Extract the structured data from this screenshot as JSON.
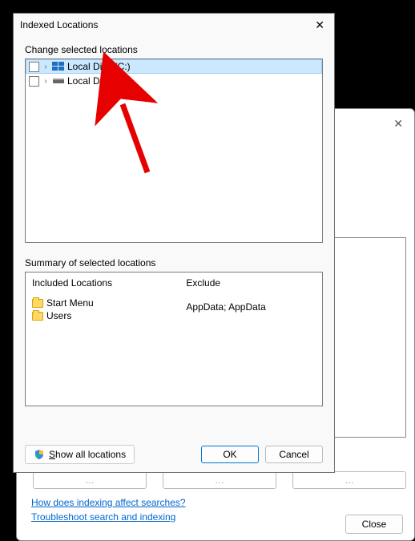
{
  "dialog": {
    "title": "Indexed Locations",
    "change_label": "Change selected locations",
    "locations": [
      {
        "label": "Local Disk (C:)",
        "selected": true,
        "icon": "win"
      },
      {
        "label": "Local Disk (E:)",
        "selected": false,
        "icon": "drive"
      }
    ],
    "summary_label": "Summary of selected locations",
    "included_header": "Included Locations",
    "exclude_header": "Exclude",
    "included": [
      {
        "label": "Start Menu"
      },
      {
        "label": "Users"
      }
    ],
    "exclude_text": "AppData; AppData",
    "show_all_label": "Show all locations",
    "ok_label": "OK",
    "cancel_label": "Cancel"
  },
  "parent": {
    "link1": "How does indexing affect searches?",
    "link2": "Troubleshoot search and indexing",
    "close_label": "Close"
  }
}
